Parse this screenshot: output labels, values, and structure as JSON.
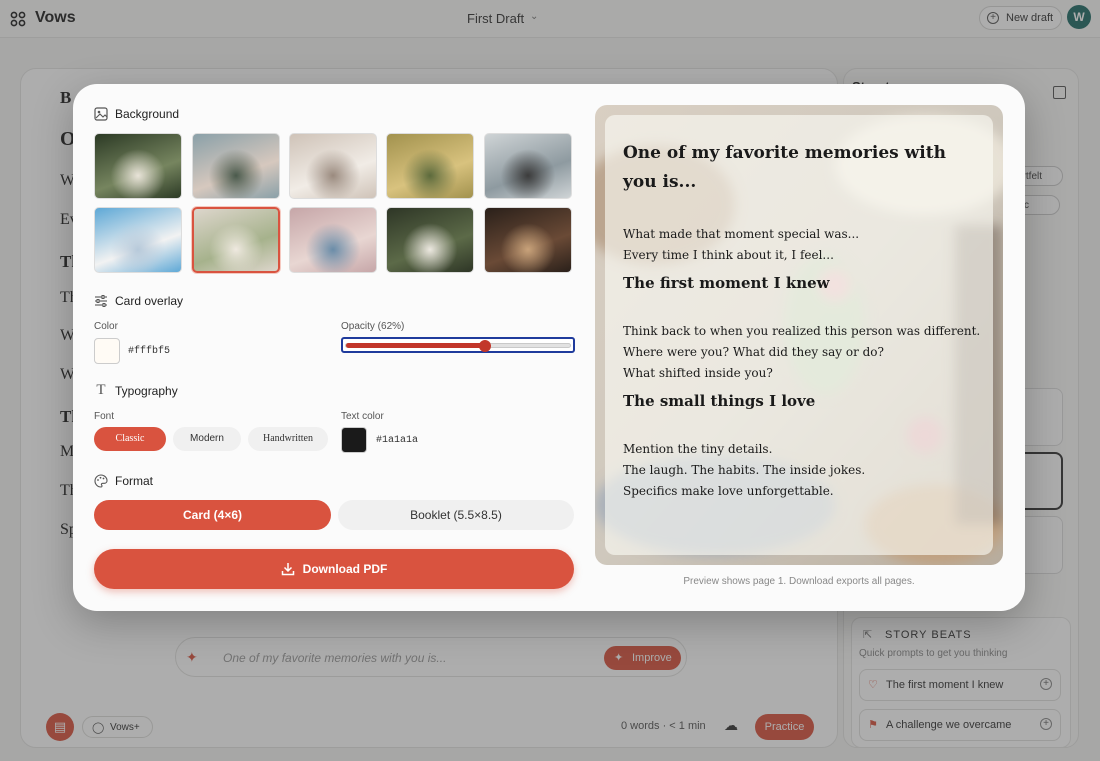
{
  "app": {
    "name": "Vows",
    "draft_title": "First Draft",
    "new_draft_label": "New draft",
    "avatar_initial": "W"
  },
  "editor": {
    "prompt_placeholder": "One of my favorite memories with you is...",
    "improve_label": "Improve",
    "vows_plus_label": "Vows+",
    "word_count": "0 words · < 1 min",
    "practice_label": "Practice"
  },
  "side_panel": {
    "title": "Structure",
    "story_beats_title": "STORY BEATS",
    "story_beats_subtitle": "Quick prompts to get you thinking",
    "beats": [
      "The first moment I knew",
      "A challenge we overcame"
    ]
  },
  "modal": {
    "background": {
      "label": "Background",
      "thumbnails": [
        {
          "name": "couple-under-trees",
          "colors": [
            "#2c3a25",
            "#76855f",
            "#e8e3d8"
          ]
        },
        {
          "name": "confetti-celebration",
          "colors": [
            "#8aa0a8",
            "#d6c8be",
            "#4a5a4c"
          ]
        },
        {
          "name": "holding-hands-rings",
          "colors": [
            "#cfc3b8",
            "#f1ece6",
            "#9a8a7e"
          ]
        },
        {
          "name": "couple-golden-field",
          "colors": [
            "#a2924e",
            "#d8c27e",
            "#5c6a3c"
          ]
        },
        {
          "name": "beach-couple",
          "colors": [
            "#cfd4d6",
            "#8e9aa0",
            "#3c3c3c"
          ]
        },
        {
          "name": "bride-seaside-flowers",
          "colors": [
            "#5ea8d6",
            "#f2f2f2",
            "#b6c9da"
          ]
        },
        {
          "name": "reception-table-flowers",
          "colors": [
            "#ddd6cc",
            "#a6b28c",
            "#efe9e0"
          ]
        },
        {
          "name": "poolside-ceremony",
          "colors": [
            "#c6a6a8",
            "#e8d6d2",
            "#6a8ca8"
          ]
        },
        {
          "name": "couple-garden-dark",
          "colors": [
            "#2e3626",
            "#5c6a48",
            "#ece8e0"
          ]
        },
        {
          "name": "evening-lights",
          "colors": [
            "#2a201a",
            "#6a4a36",
            "#c8a27a"
          ]
        }
      ],
      "selected_index": 6
    },
    "card_overlay": {
      "label": "Card overlay",
      "color_label": "Color",
      "color_value": "#fffbf5",
      "opacity_label": "Opacity (62%)",
      "opacity": 0.62
    },
    "typography": {
      "label": "Typography",
      "font_label": "Font",
      "fonts": [
        "Classic",
        "Modern",
        "Handwritten"
      ],
      "active_font": "Classic",
      "text_color_label": "Text color",
      "text_color_value": "#1a1a1a"
    },
    "format": {
      "label": "Format",
      "options": [
        "Card (4×6)",
        "Booklet (5.5×8.5)"
      ],
      "active": "Card (4×6)"
    },
    "download_label": "Download PDF",
    "preview": {
      "title": "One of my favorite memories with you is...",
      "intro_lines": [
        "What made that moment special was...",
        "Every time I think about it, I feel..."
      ],
      "heading1": "The first moment I knew",
      "section1_lines": [
        "Think back to when you realized this person was different.",
        "Where were you? What did they say or do?",
        "What shifted inside you?"
      ],
      "heading2": "The small things I love",
      "section2_lines": [
        "Mention the tiny details.",
        "The laugh. The habits. The inside jokes.",
        "Specifics make love unforgettable."
      ],
      "note": "Preview shows page 1. Download exports all pages."
    }
  },
  "colors": {
    "accent": "#d9533f",
    "slider_focus": "#1f3b9c"
  }
}
